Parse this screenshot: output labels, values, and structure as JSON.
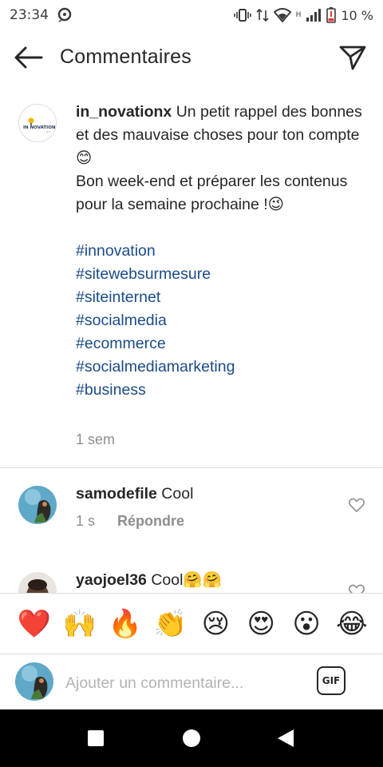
{
  "status_bar": {
    "time": "23:34",
    "battery": "10 %",
    "network_label": "H"
  },
  "header": {
    "title": "Commentaires",
    "back_icon": "arrow-left-icon",
    "send_icon": "paper-plane-icon"
  },
  "caption": {
    "username": "in_novationx",
    "avatar_logo_text": "IN NOVATION",
    "lines": [
      "Un petit rappel des bonnes et des mauvaise choses pour ton compte 😊",
      "Bon week-end et préparer les contenus pour la semaine prochaine !😉"
    ],
    "hashtags": [
      "#innovation",
      "#sitewebsurmesure",
      "#siteinternet",
      "#socialmedia",
      "#ecommerce",
      "#socialmediamarketing",
      "#business"
    ],
    "time": "1 sem"
  },
  "comments": [
    {
      "username": "samodefile",
      "text": "Cool",
      "time": "1 s",
      "reply_label": "Répondre"
    },
    {
      "username": "yaojoel36",
      "text": "Cool🤗🤗",
      "time": "",
      "reply_label": ""
    }
  ],
  "emoji_bar": [
    "❤️",
    "🙌",
    "🔥",
    "👏",
    "😢",
    "😍",
    "😮",
    "😂"
  ],
  "composer": {
    "placeholder": "Ajouter un commentaire...",
    "gif_label": "GIF"
  },
  "colors": {
    "hashtag": "#1a4b87",
    "secondary_text": "#8e8e8e",
    "divider": "#dbdbdb",
    "battery_low": "#e53935"
  }
}
